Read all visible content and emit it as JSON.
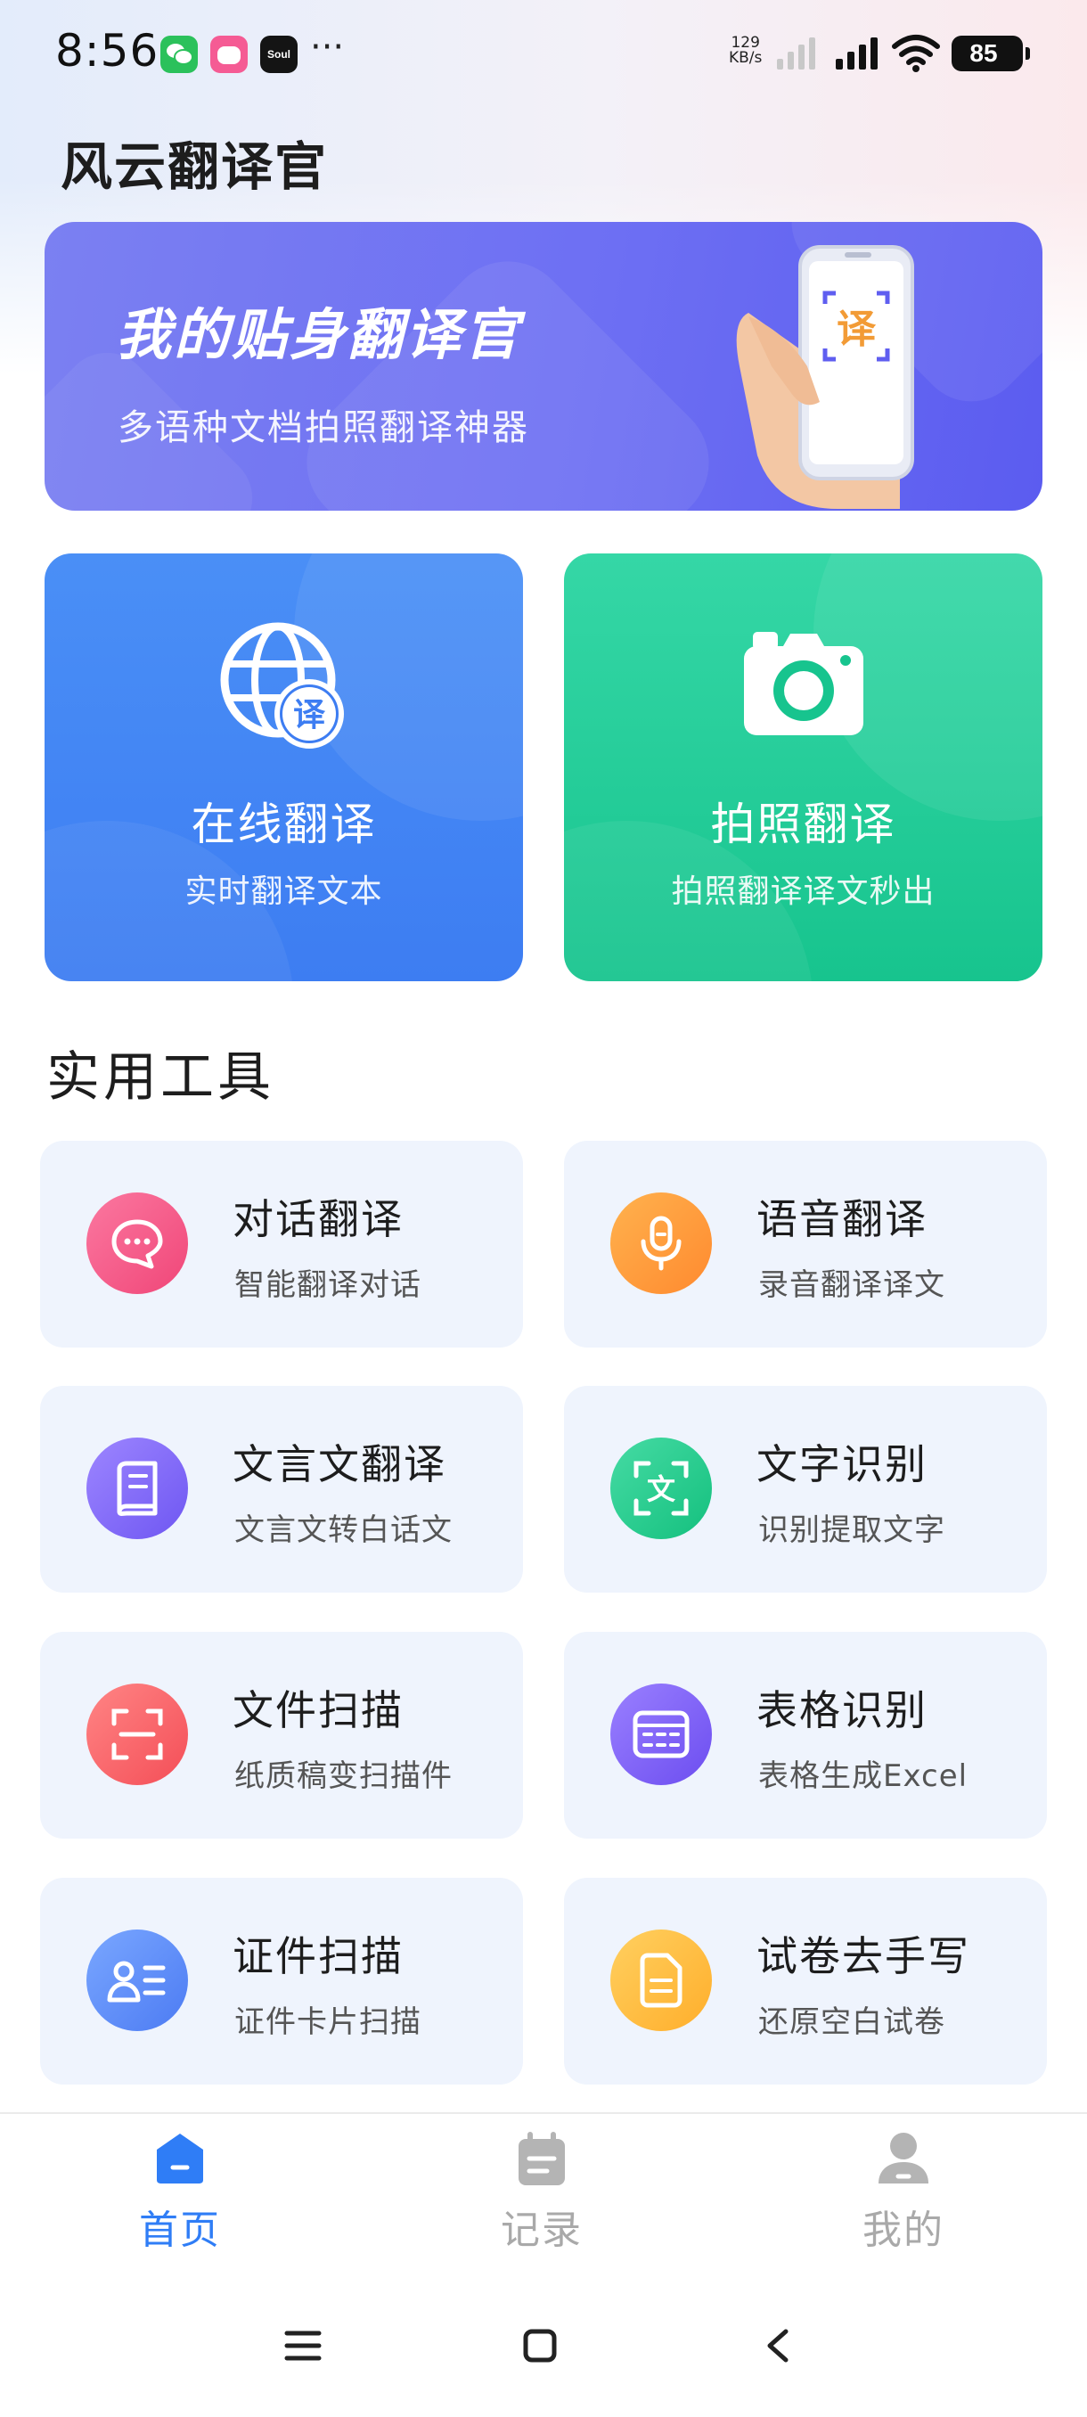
{
  "status_bar": {
    "time": "8:56",
    "more": "···",
    "soul_label": "Soul",
    "net_speed_value": "129",
    "net_speed_unit": "KB/s",
    "battery": "85"
  },
  "app": {
    "title": "风云翻译官"
  },
  "banner": {
    "title": "我的贴身翻译官",
    "subtitle": "多语种文档拍照翻译神器",
    "phone_glyph": "译"
  },
  "cards": [
    {
      "title": "在线翻译",
      "subtitle": "实时翻译文本",
      "icon": "globe-translate-icon",
      "icon_glyph": "译",
      "color": "#3d7df2"
    },
    {
      "title": "拍照翻译",
      "subtitle": "拍照翻译译文秒出",
      "icon": "camera-icon",
      "color": "#17c48e"
    }
  ],
  "tools_section": {
    "title": "实用工具",
    "items": [
      {
        "title": "对话翻译",
        "subtitle": "智能翻译对话",
        "icon": "chat-bubble-icon",
        "color": "#f04678"
      },
      {
        "title": "语音翻译",
        "subtitle": "录音翻译译文",
        "icon": "microphone-icon",
        "color": "#ff8a2f"
      },
      {
        "title": "文言文翻译",
        "subtitle": "文言文转白话文",
        "icon": "book-icon",
        "color": "#6e56f2"
      },
      {
        "title": "文字识别",
        "subtitle": "识别提取文字",
        "icon": "text-scan-icon",
        "icon_glyph": "文",
        "color": "#14c07e"
      },
      {
        "title": "文件扫描",
        "subtitle": "纸质稿变扫描件",
        "icon": "document-scan-icon",
        "color": "#f44e57"
      },
      {
        "title": "表格识别",
        "subtitle": "表格生成Excel",
        "icon": "table-icon",
        "color": "#6c4df0"
      },
      {
        "title": "证件扫描",
        "subtitle": "证件卡片扫描",
        "icon": "id-card-icon",
        "color": "#4c7bf3"
      },
      {
        "title": "试卷去手写",
        "subtitle": "还原空白试卷",
        "icon": "exam-paper-icon",
        "color": "#ffae2b"
      }
    ]
  },
  "bottom_nav": {
    "items": [
      {
        "label": "首页",
        "icon": "home-icon",
        "active": true
      },
      {
        "label": "记录",
        "icon": "calendar-icon",
        "active": false
      },
      {
        "label": "我的",
        "icon": "user-icon",
        "active": false
      }
    ],
    "active_color": "#2f7df6",
    "inactive_color": "#a9a9a9"
  },
  "system_nav": {
    "buttons": [
      "menu-icon",
      "home-square-icon",
      "back-icon"
    ]
  }
}
